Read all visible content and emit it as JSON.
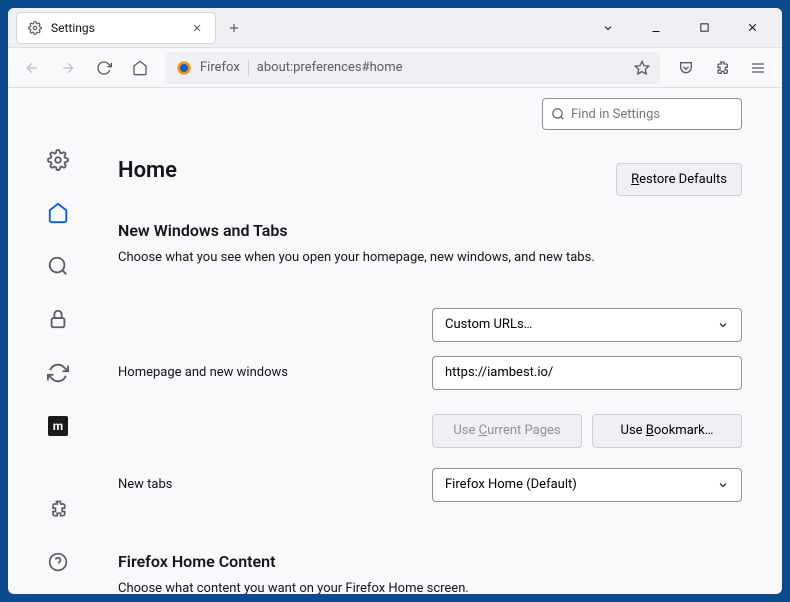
{
  "tab": {
    "title": "Settings"
  },
  "urlbar": {
    "identity": "Firefox",
    "url": "about:preferences#home"
  },
  "search": {
    "placeholder": "Find in Settings"
  },
  "page": {
    "title": "Home"
  },
  "restore": {
    "label_prefix": "R",
    "label_rest": "estore Defaults"
  },
  "sections": {
    "newWindows": {
      "title": "New Windows and Tabs",
      "desc": "Choose what you see when you open your homepage, new windows, and new tabs."
    },
    "firefoxHome": {
      "title": "Firefox Home Content",
      "desc": "Choose what content you want on your Firefox Home screen."
    }
  },
  "form": {
    "homepage_label": "Homepage and new windows",
    "homepage_dropdown": "Custom URLs…",
    "homepage_value": "https://iambest.io/",
    "use_current_prefix": "Use ",
    "use_current_u": "C",
    "use_current_rest": "urrent Pages",
    "use_bookmark_prefix": "Use ",
    "use_bookmark_u": "B",
    "use_bookmark_rest": "ookmark…",
    "newtabs_label": "New tabs",
    "newtabs_value": "Firefox Home (Default)"
  },
  "mdn_badge": "m"
}
